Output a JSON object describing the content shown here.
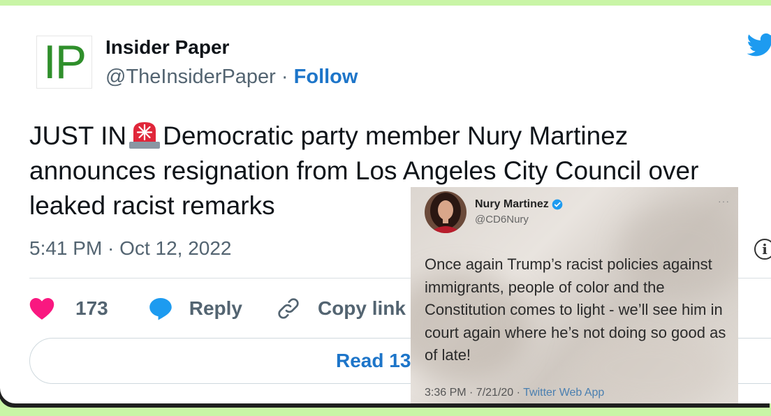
{
  "tweet": {
    "author": {
      "name": "Insider Paper",
      "handle": "@TheInsiderPaper",
      "separator": "·",
      "follow_label": "Follow",
      "logo_text": "IP"
    },
    "text_before_emoji": "JUST IN",
    "emoji": "siren-icon",
    "text_after_emoji": "Democratic party member Nury Martinez announces resignation from Los Angeles City Council over leaked racist remarks",
    "timestamp": "5:41 PM · Oct 12, 2022",
    "actions": {
      "like_count": "173",
      "reply_label": "Reply",
      "copy_link_label": "Copy link"
    },
    "read_replies_label": "Read 13"
  },
  "embedded_screenshot": {
    "name": "Nury Martinez",
    "handle": "@CD6Nury",
    "more": "···",
    "text": "Once again Trump’s racist policies against immigrants, people of color and the Constitution comes to light - we’ll see him in court again where he’s not doing so good as of late!",
    "time": "3:36 PM · 7/21/20 ·",
    "app": "Twitter Web App"
  },
  "colors": {
    "accent": "#1d75c9",
    "like": "#f91880",
    "reply": "#1d9bf0",
    "logo_green": "#2f8f2b",
    "page_bg": "#c9f5a6"
  }
}
